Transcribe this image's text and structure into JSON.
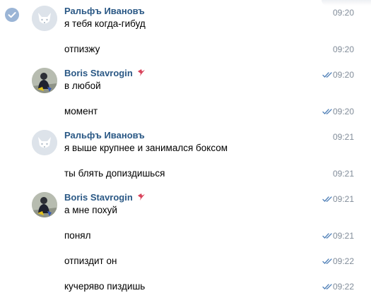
{
  "messages": [
    {
      "author": "Ральфъ Ивановъ",
      "text": "я тебя когда-гибуд",
      "time": "09:20"
    },
    {
      "text": "отпизжу",
      "time": "09:20"
    },
    {
      "author": "Boris Stavrogin",
      "text": "в любой",
      "time": "09:20",
      "read": true
    },
    {
      "text": "момент",
      "time": "09:20",
      "read": true
    },
    {
      "author": "Ральфъ Ивановъ",
      "text": "я выше крупнее и занимался боксом",
      "time": "09:21"
    },
    {
      "text": "ты блять допиздишься",
      "time": "09:21"
    },
    {
      "author": "Boris Stavrogin",
      "text": "а мне похуй",
      "time": "09:21",
      "read": true
    },
    {
      "text": "понял",
      "time": "09:21",
      "read": true
    },
    {
      "text": "отпиздит он",
      "time": "09:22",
      "read": true
    },
    {
      "text": "кучеряво пиздишь",
      "time": "09:22",
      "read": true
    }
  ],
  "colors": {
    "author": "#2a5885",
    "time": "#818c99",
    "read_tick": "#5181b8",
    "select_check": "#9bb5d6"
  },
  "icons": {
    "selected": "check-circle-icon",
    "read": "double-check-icon",
    "author_badge": "bird-emoji-icon"
  }
}
